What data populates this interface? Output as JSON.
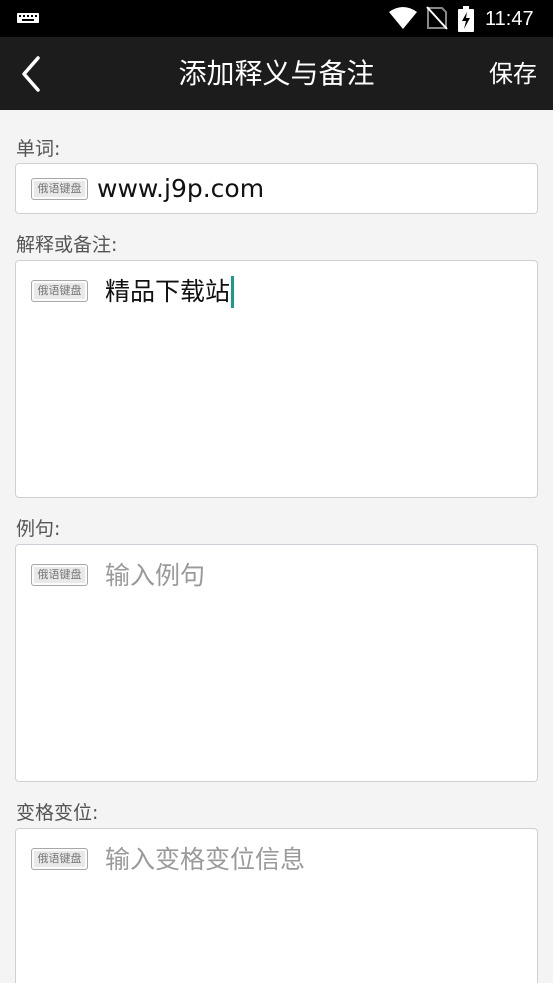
{
  "status_bar": {
    "time": "11:47",
    "icons": [
      "keyboard-icon",
      "wifi-icon",
      "no-sim-icon",
      "battery-charging-icon"
    ]
  },
  "header": {
    "title": "添加释义与备注",
    "save_label": "保存",
    "back_icon": "chevron-left-icon"
  },
  "form": {
    "keyboard_badge": "俄语键盘",
    "word": {
      "label": "单词:",
      "value": "www.j9p.com"
    },
    "definition": {
      "label": "解释或备注:",
      "value": "精品下载站"
    },
    "example": {
      "label": "例句:",
      "placeholder": "输入例句"
    },
    "inflection": {
      "label": "变格变位:",
      "placeholder": "输入变格变位信息"
    }
  },
  "colors": {
    "title_bar": "#1c1c1c",
    "status_bar": "#000000",
    "background": "#f4f4f4",
    "cursor": "#1a9a8a"
  }
}
